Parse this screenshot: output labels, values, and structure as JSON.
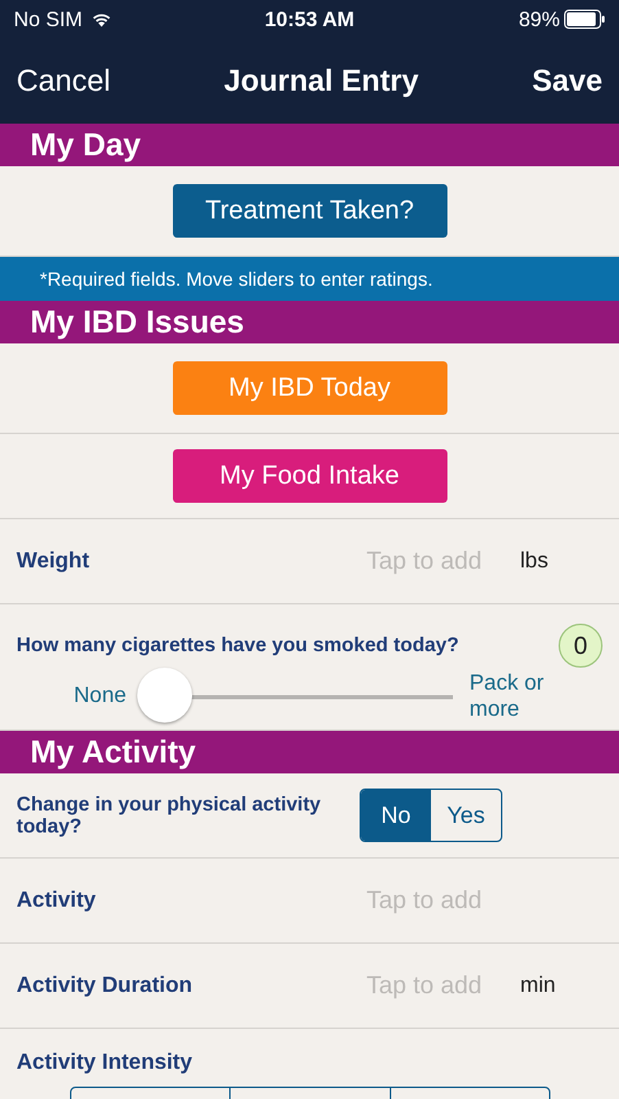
{
  "status_bar": {
    "carrier": "No SIM",
    "time": "10:53 AM",
    "battery": "89%"
  },
  "nav_bar": {
    "cancel": "Cancel",
    "title": "Journal Entry",
    "save": "Save"
  },
  "items": [
    {
      "kind": "header",
      "title": "My Day"
    },
    {
      "kind": "button",
      "label": "Treatment Taken?",
      "color": "#0c5d8e"
    },
    {
      "kind": "note",
      "text": "*Required fields. Move sliders to enter ratings."
    },
    {
      "kind": "header",
      "title": "My IBD Issues"
    },
    {
      "kind": "button",
      "label": "My IBD Today",
      "color": "#fb8112"
    },
    {
      "kind": "button",
      "label": "My Food Intake",
      "color": "#d81d7c"
    },
    {
      "kind": "field",
      "label": "Weight",
      "placeholder": "Tap to add",
      "unit": "lbs"
    },
    {
      "kind": "slider",
      "label": "How many cigarettes have you smoked today?",
      "value": "0",
      "min_label": "None",
      "max_label": "Pack or more",
      "level": 0
    },
    {
      "kind": "header",
      "title": "My Activity"
    },
    {
      "kind": "toggle",
      "label": "Change in your physical activity today?",
      "options": [
        {
          "label": "No",
          "selected": true
        },
        {
          "label": "Yes",
          "selected": false
        }
      ]
    },
    {
      "kind": "field",
      "label": "Activity",
      "placeholder": "Tap to add"
    },
    {
      "kind": "field",
      "label": "Activity Duration",
      "placeholder": "Tap to add",
      "unit": "min"
    },
    {
      "kind": "segments",
      "label": "Activity Intensity"
    }
  ]
}
